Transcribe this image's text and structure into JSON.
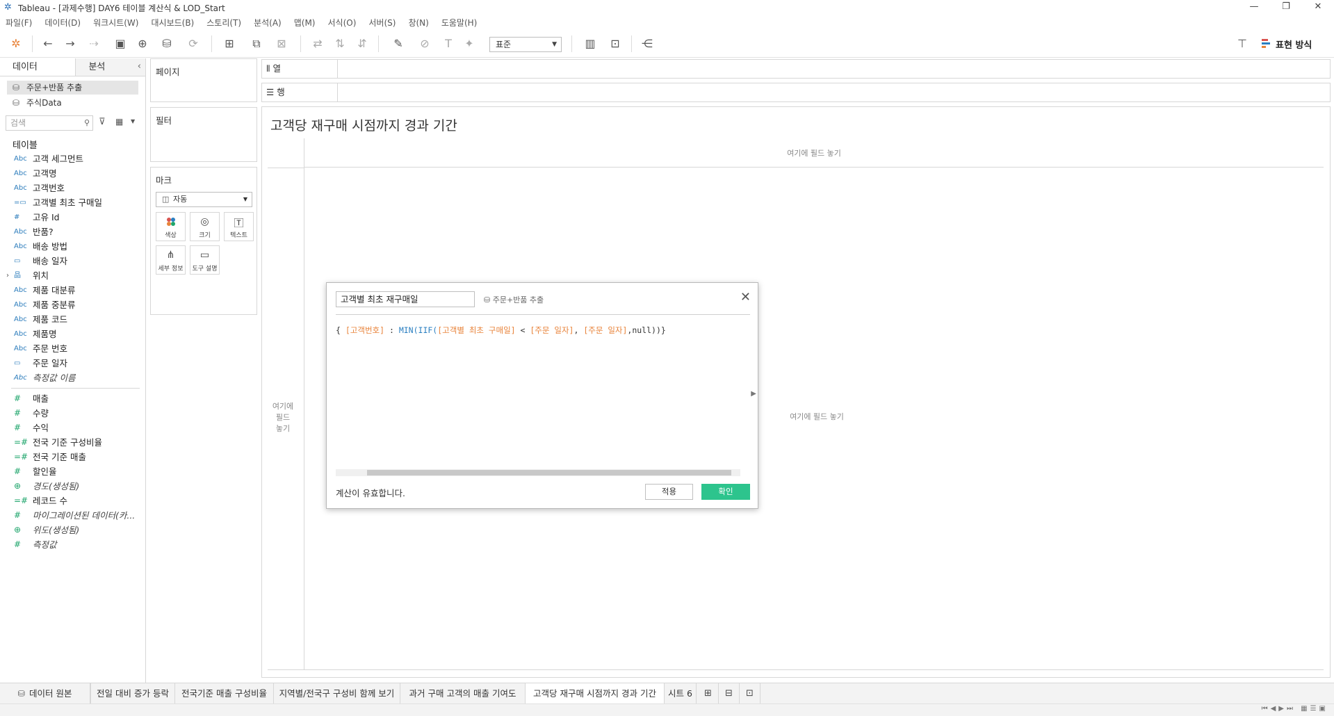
{
  "window": {
    "title": "Tableau - [과제수행] DAY6 테이블 계산식 & LOD_Start",
    "controls": [
      "—",
      "❐",
      "✕"
    ]
  },
  "menu": [
    "파일(F)",
    "데이터(D)",
    "워크시트(W)",
    "대시보드(B)",
    "스토리(T)",
    "분석(A)",
    "맵(M)",
    "서식(O)",
    "서버(S)",
    "창(N)",
    "도움말(H)"
  ],
  "toolbar": {
    "fit_select": "표준",
    "show_me_label": "표현 방식"
  },
  "data_pane": {
    "tab_data": "데이터",
    "tab_analytics": "분석",
    "datasources": [
      {
        "name": "주문+반품 추출",
        "selected": true
      },
      {
        "name": "주식Data",
        "selected": false
      }
    ],
    "search_placeholder": "검색",
    "tables_title": "테이블",
    "dimensions": [
      {
        "icon": "Abc",
        "name": "고객 세그먼트"
      },
      {
        "icon": "Abc",
        "name": "고객명"
      },
      {
        "icon": "Abc",
        "name": "고객번호"
      },
      {
        "icon": "=▭",
        "name": "고객별 최초 구매일"
      },
      {
        "icon": "#",
        "name": "고유 Id"
      },
      {
        "icon": "Abc",
        "name": "반품?"
      },
      {
        "icon": "Abc",
        "name": "배송 방법"
      },
      {
        "icon": "▭",
        "name": "배송 일자"
      },
      {
        "icon": "品",
        "name": "위치"
      },
      {
        "icon": "Abc",
        "name": "제품 대분류"
      },
      {
        "icon": "Abc",
        "name": "제품 중분류"
      },
      {
        "icon": "Abc",
        "name": "제품 코드"
      },
      {
        "icon": "Abc",
        "name": "제품명"
      },
      {
        "icon": "Abc",
        "name": "주문 번호"
      },
      {
        "icon": "▭",
        "name": "주문 일자"
      },
      {
        "icon": "Abc",
        "name": "측정값 이름"
      }
    ],
    "measures": [
      {
        "icon": "#",
        "name": "매출"
      },
      {
        "icon": "#",
        "name": "수량"
      },
      {
        "icon": "#",
        "name": "수익"
      },
      {
        "icon": "=#",
        "name": "전국 기준 구성비율"
      },
      {
        "icon": "=#",
        "name": "전국 기준 매출"
      },
      {
        "icon": "#",
        "name": "할인율"
      },
      {
        "icon": "⊕",
        "name": "경도(생성됨)"
      },
      {
        "icon": "=#",
        "name": "레코드 수"
      },
      {
        "icon": "#",
        "name": "마이그레이션된 데이터(카..."
      },
      {
        "icon": "⊕",
        "name": "위도(생성됨)"
      },
      {
        "icon": "#",
        "name": "측정값"
      }
    ]
  },
  "shelves": {
    "pages": "페이지",
    "filters": "필터",
    "marks": "마크",
    "marks_type": "자동",
    "mark_buttons": [
      {
        "label": "색상"
      },
      {
        "label": "크기"
      },
      {
        "label": "텍스트"
      },
      {
        "label": "세부 정보"
      },
      {
        "label": "도구 설명"
      }
    ],
    "columns": "열",
    "rows": "행"
  },
  "view": {
    "sheet_title": "고객당 재구매 시점까지 경과 기간",
    "drop_field_top": "여기에 필드 놓기",
    "drop_field_left_1": "여기에",
    "drop_field_left_2": "필드",
    "drop_field_left_3": "놓기",
    "drop_field_center": "여기에 필드 놓기"
  },
  "calc_dialog": {
    "name": "고객별 최초 재구매일",
    "source": "주문+반품 추출",
    "formula": {
      "brace_open": "{",
      "field_customer": "[고객번호]",
      "colon": " : ",
      "func_min": "MIN(",
      "func_iif": "IIF(",
      "field_first": "[고객별 최초 구매일]",
      "lt": " < ",
      "field_order1": "[주문 일자]",
      "comma1": ", ",
      "field_order2": "[주문 일자]",
      "tail": ",null))}"
    },
    "valid_message": "계산이 유효합니다.",
    "apply_label": "적용",
    "ok_label": "확인"
  },
  "tabs": {
    "datasource": "데이터 원본",
    "sheets": [
      "전일 대비 증가 등락",
      "전국기준 매출 구성비율",
      "지역별/전국구 구성비 함께 보기",
      "과거 구매 고객의 매출 기여도",
      "고객당 재구매 시점까지 경과 기간",
      "시트 6"
    ],
    "active_index": 4
  },
  "colors": {
    "ok_button": "#2dc48d",
    "field_ref": "#e8833a",
    "function": "#2a7fc1",
    "measure_icon": "#1ea56b",
    "dimension_icon": "#2d7dbc"
  }
}
